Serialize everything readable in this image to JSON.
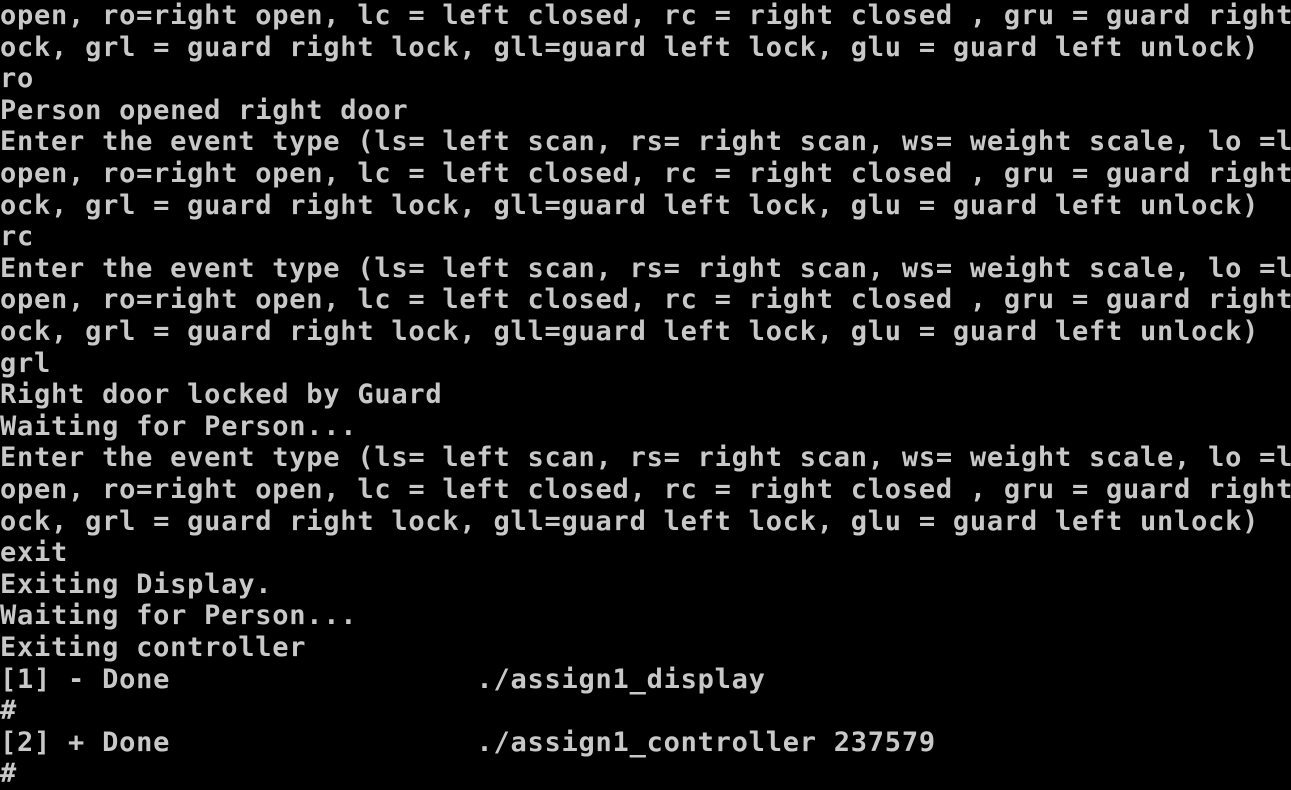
{
  "terminal": {
    "lines": [
      "open, ro=right open, lc = left closed, rc = right closed , gru = guard right unl",
      "ock, grl = guard right lock, gll=guard left lock, glu = guard left unlock)",
      "ro",
      "Person opened right door",
      "Enter the event type (ls= left scan, rs= right scan, ws= weight scale, lo =left",
      "open, ro=right open, lc = left closed, rc = right closed , gru = guard right unl",
      "ock, grl = guard right lock, gll=guard left lock, glu = guard left unlock)",
      "rc",
      "Enter the event type (ls= left scan, rs= right scan, ws= weight scale, lo =left",
      "open, ro=right open, lc = left closed, rc = right closed , gru = guard right unl",
      "ock, grl = guard right lock, gll=guard left lock, glu = guard left unlock)",
      "grl",
      "Right door locked by Guard",
      "Waiting for Person...",
      "Enter the event type (ls= left scan, rs= right scan, ws= weight scale, lo =left",
      "open, ro=right open, lc = left closed, rc = right closed , gru = guard right unl",
      "ock, grl = guard right lock, gll=guard left lock, glu = guard left unlock)",
      "exit",
      "Exiting Display.",
      "Waiting for Person...",
      "Exiting controller",
      "[1] - Done                  ./assign1_display",
      "#",
      "[2] + Done                  ./assign1_controller 237579",
      "#"
    ]
  }
}
